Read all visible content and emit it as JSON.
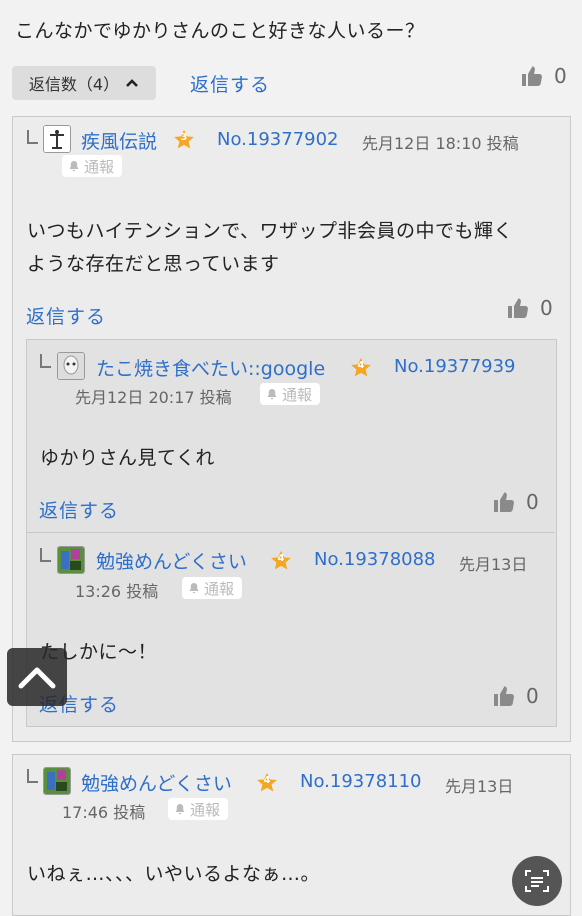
{
  "question": "こんなかでゆかりさんのこと好きな人いるー？",
  "toolbar": {
    "reply_count_label": "返信数（4）",
    "reply_label": "返信する",
    "like_count": "0"
  },
  "report_label": "通報",
  "comments": [
    {
      "name": "疾風伝説",
      "rank": "3",
      "number": "No.19377902",
      "datetime": "先月12日 18:10 投稿",
      "text_line1": "いつもハイテンションで、ワザップ非会員の中でも輝く",
      "text_line2": "ような存在だと思っています",
      "reply_label": "返信する",
      "likes": "0"
    },
    {
      "name": "たこ焼き食べたい::google",
      "rank": "4",
      "number": "No.19377939",
      "datetime": "先月12日 20:17 投稿",
      "text": "ゆかりさん見てくれ",
      "reply_label": "返信する",
      "likes": "0"
    },
    {
      "name": "勉強めんどくさい",
      "rank": "4",
      "number": "No.19378088",
      "date": "先月13日",
      "time": "13:26 投稿",
      "text": "たしかに〜！",
      "reply_label": "返信する",
      "likes": "0"
    },
    {
      "name": "勉強めんどくさい",
      "rank": "4",
      "number": "No.19378110",
      "date": "先月13日",
      "time": "17:46 投稿",
      "text": "いねぇ…、、、いやいるよなぁ…。"
    }
  ],
  "colors": {
    "link": "#2f6fc9",
    "star": "#f5a623",
    "panel_bg": "#ececec",
    "nested_bg": "#e2e2e2"
  }
}
